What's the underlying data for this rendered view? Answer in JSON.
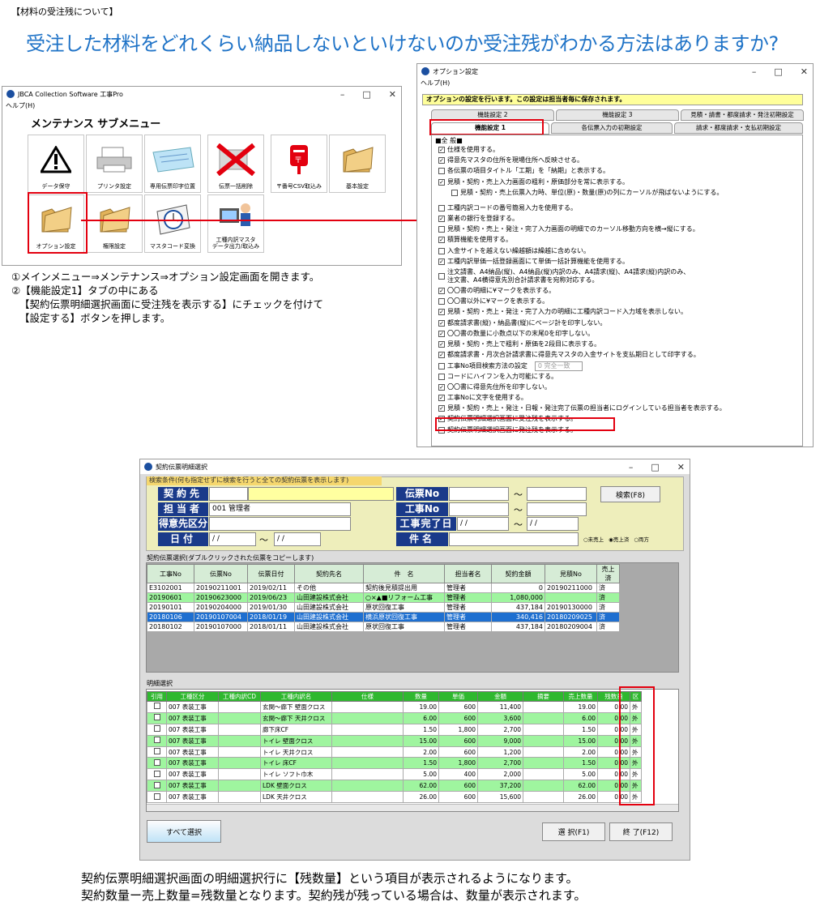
{
  "top_tag": "【材料の受注残について】",
  "headline": "受注した材料をどれくらい納品しないといけないのか受注残がわかる方法はありますか?",
  "maint_window": {
    "title": "JBCA Collection Software 工事Pro",
    "menu": "ヘルプ(H)",
    "heading": "メンテナンス サブメニュー",
    "tiles": [
      {
        "label": "データ保守",
        "icon": "warning-icon"
      },
      {
        "label": "プリンタ設定",
        "icon": "printer-icon"
      },
      {
        "label": "専用伝票印字位置",
        "icon": "form-paper-icon"
      },
      {
        "label": "伝票一括削除",
        "icon": "delete-x-icon"
      },
      {
        "label": "〒番号CSV取込み",
        "icon": "postbox-icon"
      },
      {
        "label": "基本設定",
        "icon": "folder-icon"
      },
      {
        "label": "オプション設定",
        "icon": "folder-icon"
      },
      {
        "label": "権限設定",
        "icon": "folder-icon"
      },
      {
        "label": "マスタコード変換",
        "icon": "clock-icon"
      },
      {
        "label": "工種内訳マスタ\nデータ出力/取込み",
        "icon": "computer-user-icon"
      }
    ]
  },
  "option_window": {
    "title": "オプション設定",
    "menu": "ヘルプ(H)",
    "banner": "オプションの設定を行います。この設定は担当者毎に保存されます。",
    "tabs_back": [
      "機能設定 2",
      "機能設定 3",
      "見積・請書・都度請求・発注初期設定"
    ],
    "tabs_front": [
      "機能設定 1",
      "各伝票入力の初期設定",
      "請求・都度請求・支払初期設定"
    ],
    "section": "■全 般■",
    "items": [
      {
        "checked": true,
        "text": "仕様を使用する。"
      },
      {
        "checked": true,
        "text": "得意先マスタの住所を現場住所へ反映させる。"
      },
      {
        "checked": false,
        "text": "各伝票の項目タイトル「工期」を「納期」と表示する。"
      },
      {
        "checked": true,
        "text": "見積・契約・売上入力画面の粗利・原価部分を常に表示する。"
      },
      {
        "checked": false,
        "text": "見積・契約・売上伝票入力時、単位(原)・数量(原)の列にカーソルが飛ばないようにする。",
        "indent": true
      },
      {
        "checked": false,
        "text": "工種内訳コードの番号簡易入力を使用する。"
      },
      {
        "checked": true,
        "text": "業者の銀行を登録する。"
      },
      {
        "checked": false,
        "text": "見積・契約・売上・発注・完了入力画面の明細でのカーソル移動方向を横→縦にする。"
      },
      {
        "checked": true,
        "text": "積算機能を使用する。"
      },
      {
        "checked": false,
        "text": "入金サイトを越えない繰越額は繰越に含めない。"
      },
      {
        "checked": true,
        "text": "工種内訳単価一括登録画面にて単価一括計算機能を使用する。"
      },
      {
        "checked": false,
        "text": "注文請書、A4納品(縦)、A4納品(縦)内訳のみ、A4請求(縦)、A4請求(縦)内訳のみ、\n注文書、A4横得意先別合計請求書を宛称対応する。"
      },
      {
        "checked": true,
        "text": "〇〇書の明細に¥マークを表示する。"
      },
      {
        "checked": false,
        "text": "〇〇書以外に¥マークを表示する。"
      },
      {
        "checked": true,
        "text": "見積・契約・売上・発注・完了入力の明細に工種内訳コード入力域を表示しない。"
      },
      {
        "checked": true,
        "text": "都度請求書(縦)・納品書(縦)にページ計を印字しない。"
      },
      {
        "checked": true,
        "text": "〇〇書の数量に小数点以下の末尾0を印字しない。"
      },
      {
        "checked": true,
        "text": "見積・契約・売上で粗利・原価を2段目に表示する。"
      },
      {
        "checked": true,
        "text": "都度請求書・月次合計請求書に得意先マスタの入金サイトを支払期日として印字する。"
      },
      {
        "checked": false,
        "text": "工事No項目検索方法の設定",
        "select": "0 完全一致"
      },
      {
        "checked": false,
        "text": "コードにハイフンを入力可能にする。"
      },
      {
        "checked": true,
        "text": "〇〇書に得意先住所を印字しない。"
      },
      {
        "checked": true,
        "text": "工事Noに文字を使用する。"
      },
      {
        "checked": true,
        "text": "見積・契約・売上・発注・日報・発注完了伝票の担当者にログインしている担当者を表示する。"
      },
      {
        "checked": true,
        "text": "契約伝票明細選択画面に受注残を表示する。"
      },
      {
        "checked": false,
        "text": "契約伝票明細選択画面に発注残を表示する。"
      }
    ]
  },
  "steps": [
    "①メインメニュー⇒メンテナンス⇒オプション設定画面を開きます。",
    "②【機能設定1】タブの中にある",
    "【契約伝票明細選択画面に受注残を表示する】にチェックを付けて",
    "【設定する】ボタンを押します。"
  ],
  "contract_window": {
    "title": "契約伝票明細選択",
    "cond_head": "検索条件(何も指定せずに検索を行うと全ての契約伝票を表示します)",
    "labels": {
      "keiyakusaki": "契約先",
      "tantousha": "担当者",
      "tokuisaki_kubun": "得意先区分",
      "hizuke": "日付",
      "denpyo_no": "伝票No",
      "kouji_no": "工事No",
      "kanryo": "工事完了日",
      "kenmei": "件名"
    },
    "tantousha_value": "001 管理者",
    "date_placeholder": "/ /",
    "tilde": "〜",
    "search_button": "検索(F8)",
    "radio": [
      "未売上",
      "売上済",
      "両方"
    ],
    "list_caption": "契約伝票選択(ダブルクリックされた伝票をコピーします)",
    "list_headers": [
      "工事No",
      "伝票No",
      "伝票日付",
      "契約先名",
      "件　名",
      "担当者名",
      "契約金額",
      "見積No",
      "売上済"
    ],
    "list_rows": [
      [
        "E3102001",
        "20190211001",
        "2019/02/11",
        "その他",
        "契約後見積提出用",
        "管理者",
        "0",
        "20190211000",
        "済"
      ],
      [
        "20190601",
        "20190623000",
        "2019/06/23",
        "山田建設株式会社",
        "○×▲■リフォーム工事",
        "管理者",
        "1,080,000",
        "",
        "済"
      ],
      [
        "20190101",
        "20190204000",
        "2019/01/30",
        "山田建設株式会社",
        "原状回復工事",
        "管理者",
        "437,184",
        "20190130000",
        "済"
      ],
      [
        "20180106",
        "20190107004",
        "2018/01/19",
        "山田建設株式会社",
        "横浜原状回復工事",
        "管理者",
        "340,416",
        "20180209025",
        "済"
      ],
      [
        "20180102",
        "20190107000",
        "2018/01/11",
        "山田建設株式会社",
        "原状回復工事",
        "管理者",
        "437,184",
        "20180209004",
        "済"
      ]
    ],
    "detail_caption": "明細選択",
    "detail_headers": [
      "引用",
      "工種区分",
      "工種内訳CD",
      "工種内訳名",
      "仕様",
      "数量",
      "単価",
      "金額",
      "摘要",
      "売上数量",
      "残数量",
      "区"
    ],
    "detail_rows": [
      [
        "007 表装工事",
        "",
        "玄関～廊下 壁面クロス",
        "",
        "19.00",
        "600",
        "11,400",
        "",
        "19.00",
        "0.00",
        "外"
      ],
      [
        "007 表装工事",
        "",
        "玄関～廊下 天井クロス",
        "",
        "6.00",
        "600",
        "3,600",
        "",
        "6.00",
        "0.00",
        "外"
      ],
      [
        "007 表装工事",
        "",
        "廊下床CF",
        "",
        "1.50",
        "1,800",
        "2,700",
        "",
        "1.50",
        "0.00",
        "外"
      ],
      [
        "007 表装工事",
        "",
        "トイレ 壁面クロス",
        "",
        "15.00",
        "600",
        "9,000",
        "",
        "15.00",
        "0.00",
        "外"
      ],
      [
        "007 表装工事",
        "",
        "トイレ 天井クロス",
        "",
        "2.00",
        "600",
        "1,200",
        "",
        "2.00",
        "0.00",
        "外"
      ],
      [
        "007 表装工事",
        "",
        "トイレ 床CF",
        "",
        "1.50",
        "1,800",
        "2,700",
        "",
        "1.50",
        "0.00",
        "外"
      ],
      [
        "007 表装工事",
        "",
        "トイレ ソフト巾木",
        "",
        "5.00",
        "400",
        "2,000",
        "",
        "5.00",
        "0.00",
        "外"
      ],
      [
        "007 表装工事",
        "",
        "LDK 壁面クロス",
        "",
        "62.00",
        "600",
        "37,200",
        "",
        "62.00",
        "0.00",
        "外"
      ],
      [
        "007 表装工事",
        "",
        "LDK 天井クロス",
        "",
        "26.00",
        "600",
        "15,600",
        "",
        "26.00",
        "0.00",
        "外"
      ]
    ],
    "select_all_button": "すべて選択",
    "select_button": "選 択(F1)",
    "end_button": "終 了(F12)"
  },
  "footer": [
    "契約伝票明細選択画面の明細選択行に【残数量】という項目が表示されるようになります。",
    "契約数量ー売上数量=残数量となります。契約残が残っている場合は、数量が表示されます。"
  ],
  "colors": {
    "accent_blue": "#1f73c7",
    "highlight_red": "#e3000f",
    "row_green": "#9ff59f",
    "row_selected": "#1e6fd0",
    "header_green": "#2fb82f",
    "label_navy": "#1a3a8a"
  }
}
